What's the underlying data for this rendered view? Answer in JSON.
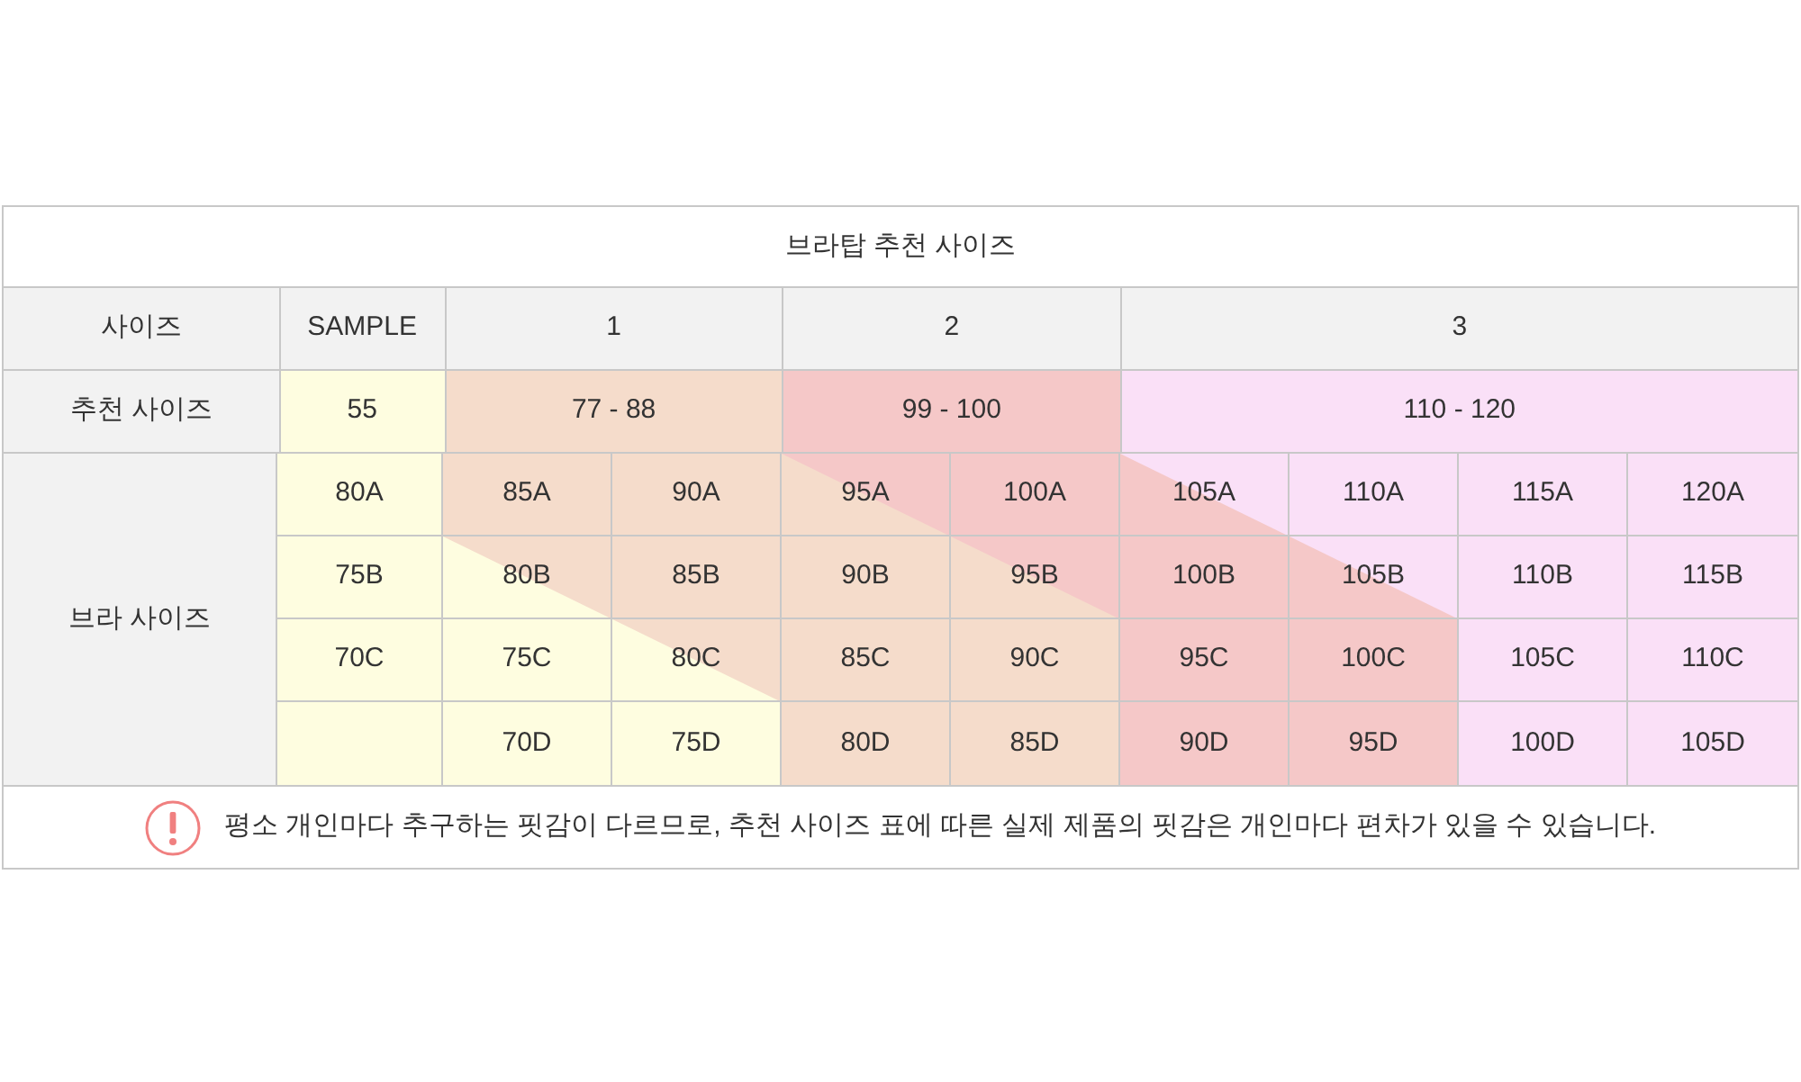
{
  "title": "브라탑 추천 사이즈",
  "header": {
    "label": "사이즈",
    "columns": [
      {
        "label": "SAMPLE"
      },
      {
        "label": "1"
      },
      {
        "label": "2"
      },
      {
        "label": "3"
      }
    ]
  },
  "recommended": {
    "label": "추천 사이즈",
    "groups": [
      {
        "label": "55",
        "color": "#fefde0"
      },
      {
        "label": "77 - 88",
        "color": "#f5dccb"
      },
      {
        "label": "99 - 100",
        "color": "#f5c8c8"
      },
      {
        "label": "110 - 120",
        "color": "#fae0f7"
      }
    ]
  },
  "bra": {
    "label": "브라 사이즈",
    "rows": [
      [
        "80A",
        "85A",
        "90A",
        "95A",
        "100A",
        "105A",
        "110A",
        "115A",
        "120A"
      ],
      [
        "75B",
        "80B",
        "85B",
        "90B",
        "95B",
        "100B",
        "105B",
        "110B",
        "115B"
      ],
      [
        "70C",
        "75C",
        "80C",
        "85C",
        "90C",
        "95C",
        "100C",
        "105C",
        "110C"
      ],
      [
        "",
        "70D",
        "75D",
        "80D",
        "85D",
        "90D",
        "95D",
        "100D",
        "105D"
      ]
    ]
  },
  "notice": {
    "text": "평소 개인마다 추구하는 핏감이 다르므로, 추천 사이즈 표에 따른 실제 제품의 핏감은 개인마다 편차가 있을 수 있습니다."
  }
}
